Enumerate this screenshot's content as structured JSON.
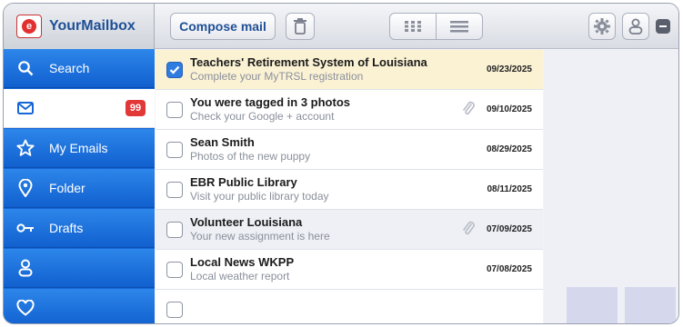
{
  "app": {
    "name": "YourMailbox"
  },
  "toolbar": {
    "compose_label": "Compose mail"
  },
  "icons": {
    "logo": "mail-logo-icon",
    "trash": "trash-icon",
    "grid": "grid-view-icon",
    "list": "list-view-icon",
    "gear": "gear-icon",
    "user": "user-icon",
    "menu": "menu-icon"
  },
  "colors": {
    "accent": "#1f4f96",
    "sidebar": "#1566d6",
    "badge": "#e23838",
    "selected_row": "#fbf2d4"
  },
  "sidebar": {
    "items": [
      {
        "label": "Search",
        "icon": "search-icon"
      },
      {
        "label": "",
        "icon": "envelope-icon",
        "badge": "99"
      },
      {
        "label": "My Emails",
        "icon": "star-icon"
      },
      {
        "label": "Folder",
        "icon": "location-pin-icon"
      },
      {
        "label": "Drafts",
        "icon": "key-icon"
      },
      {
        "label": "",
        "icon": "user-icon"
      },
      {
        "label": "",
        "icon": "heart-icon"
      }
    ]
  },
  "emails": [
    {
      "sender": "Teachers' Retirement System of Louisiana",
      "preview": "Complete your MyTRSL registration",
      "date": "09/23/2025",
      "checked": true,
      "attachment": false
    },
    {
      "sender": "You were tagged in 3 photos",
      "preview": "Check your Google + account",
      "date": "09/10/2025",
      "checked": false,
      "attachment": true
    },
    {
      "sender": "Sean Smith",
      "preview": "Photos of the new puppy",
      "date": "08/29/2025",
      "checked": false,
      "attachment": false
    },
    {
      "sender": "EBR Public Library",
      "preview": "Visit your public library today",
      "date": "08/11/2025",
      "checked": false,
      "attachment": false
    },
    {
      "sender": "Volunteer Louisiana",
      "preview": "Your new assignment is here",
      "date": "07/09/2025",
      "checked": false,
      "attachment": true
    },
    {
      "sender": "Local News WKPP",
      "preview": "Local weather report",
      "date": "07/08/2025",
      "checked": false,
      "attachment": false
    },
    {
      "sender": "",
      "preview": "",
      "date": "",
      "checked": false,
      "attachment": false
    }
  ]
}
